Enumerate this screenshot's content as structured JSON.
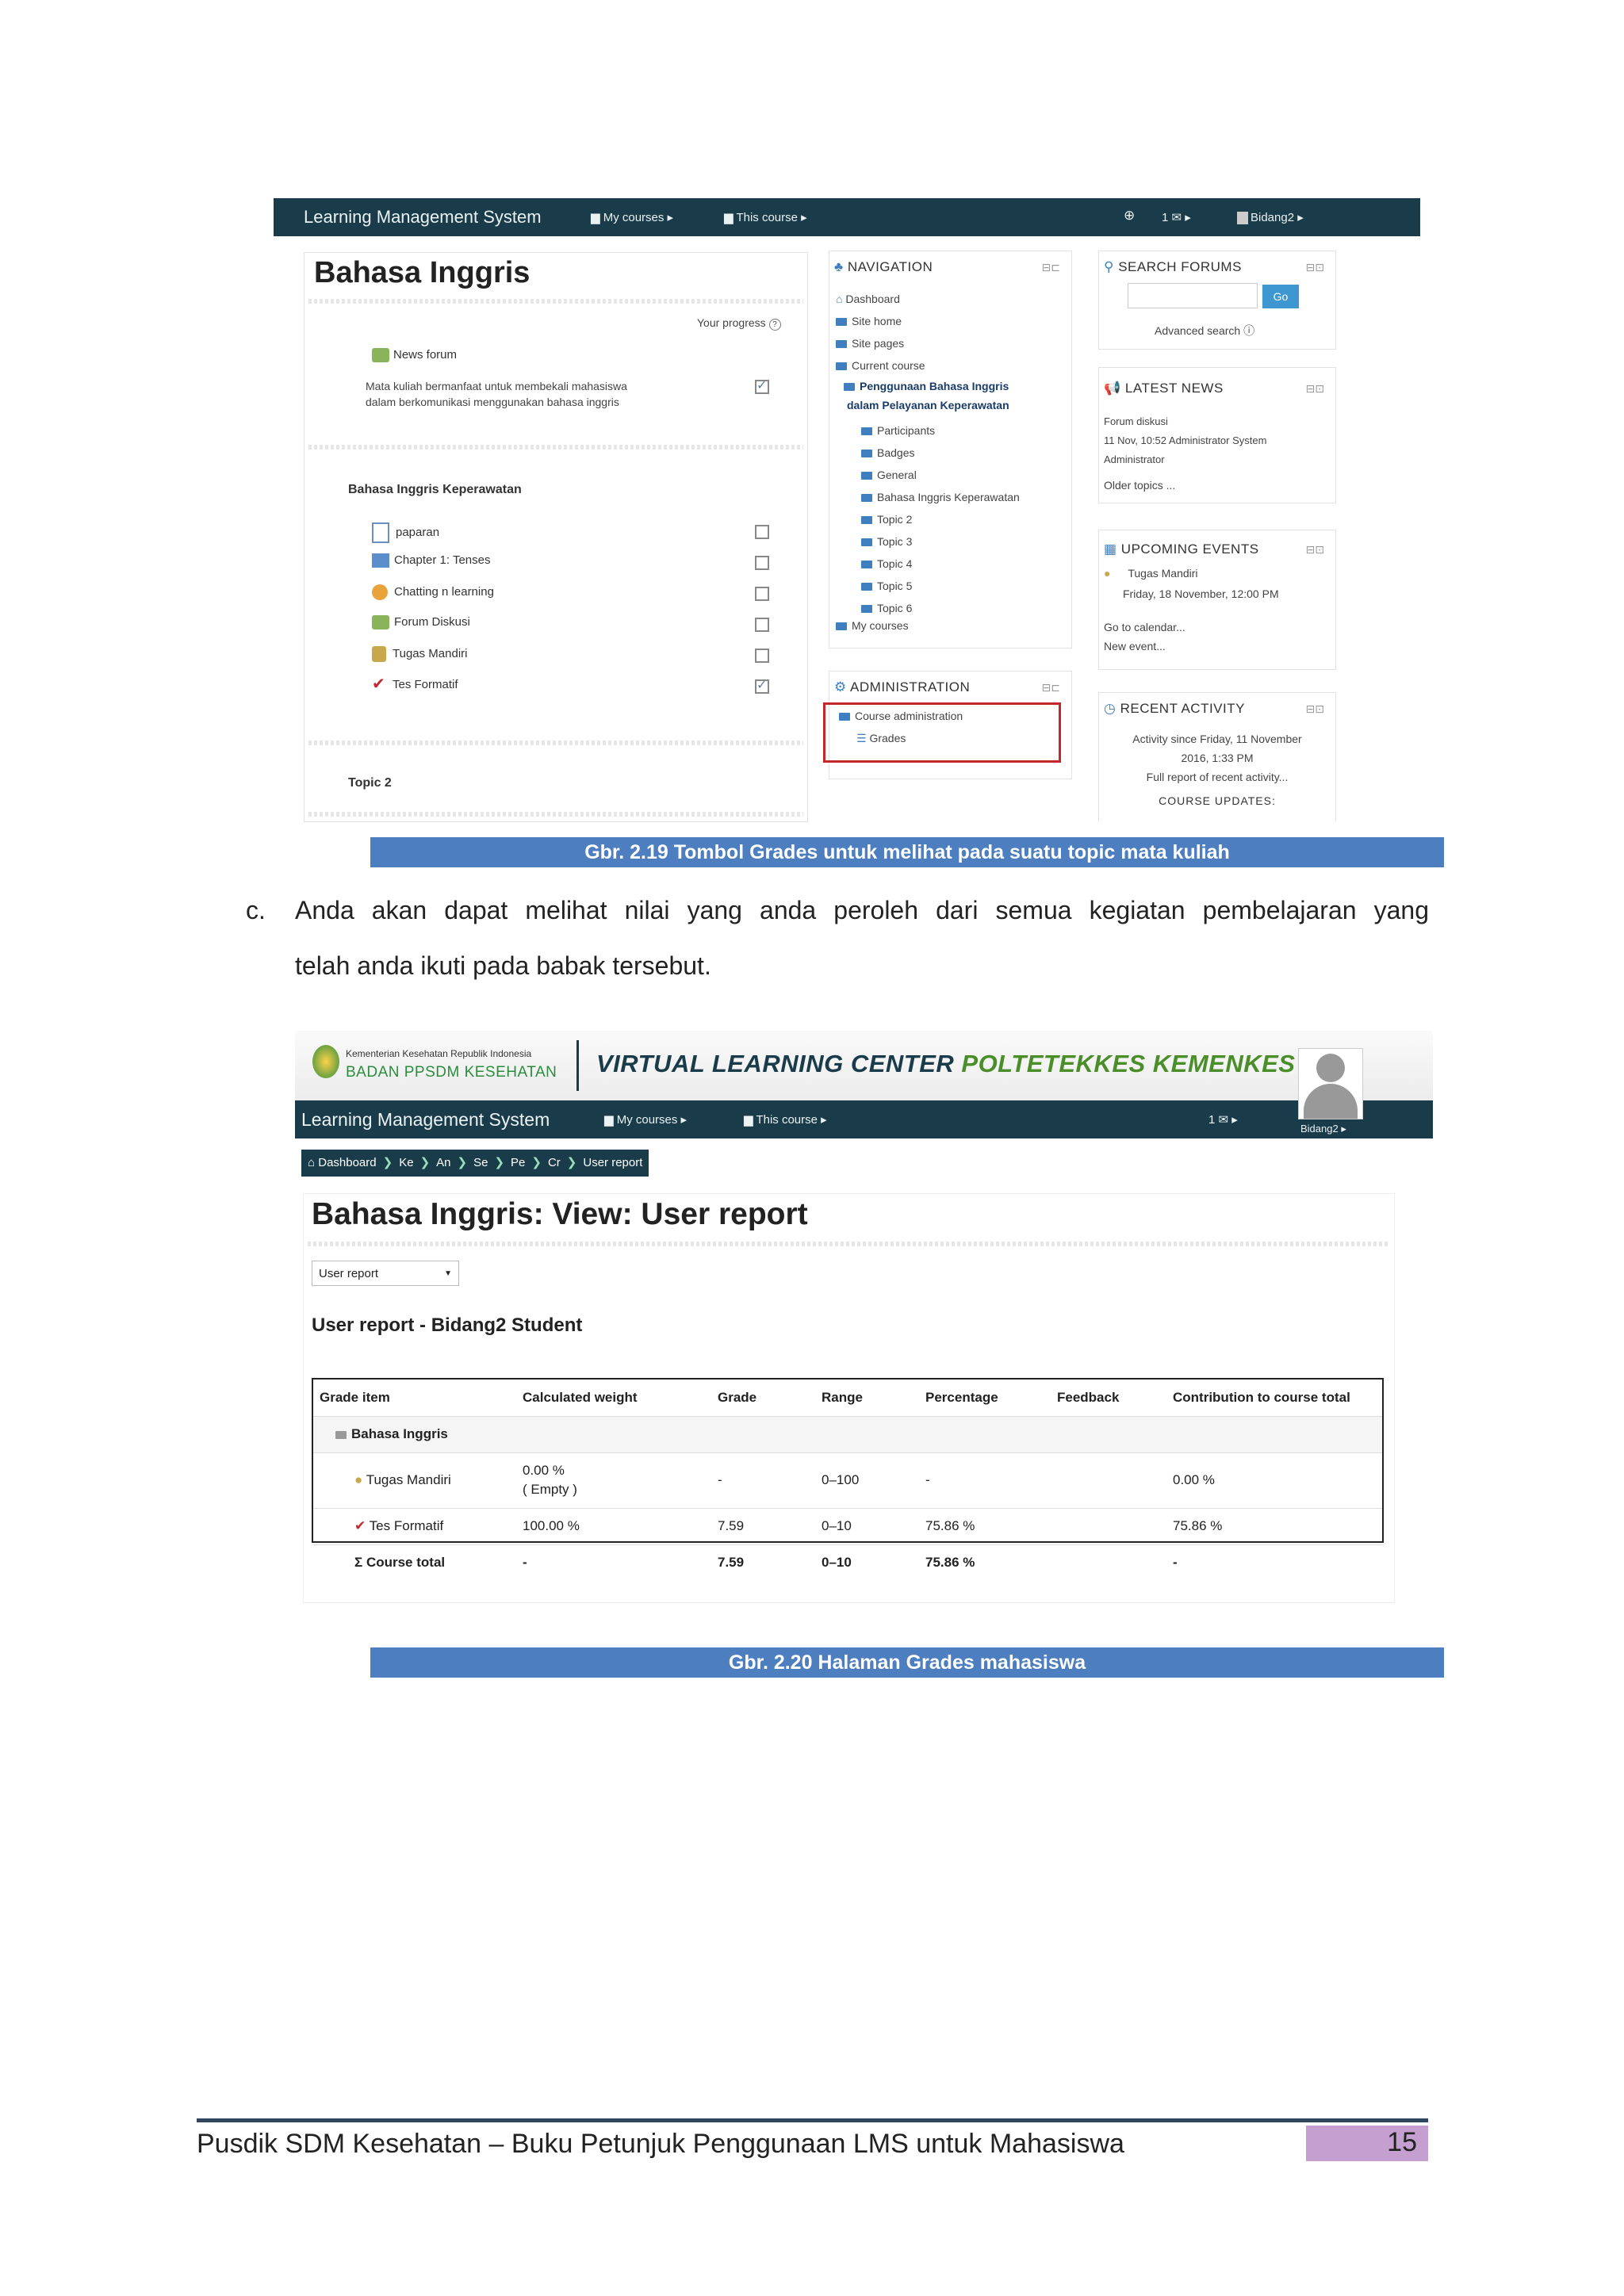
{
  "fig1": {
    "topbar": {
      "brand": "Learning Management System",
      "my_courses": "My courses ▸",
      "this_course": "This course ▸",
      "messages": "1 ✉ ▸",
      "user": "Bidang2 ▸"
    },
    "course_title": "Bahasa Inggris",
    "your_progress": "Your progress",
    "news_forum": "News forum",
    "description": [
      "Mata kuliah bermanfaat untuk membekali mahasiswa",
      "dalam berkomunikasi menggunakan bahasa inggris"
    ],
    "section_title": "Bahasa Inggris Keperawatan",
    "activities": [
      {
        "label": "paparan",
        "checked": false
      },
      {
        "label": "Chapter 1: Tenses",
        "checked": false
      },
      {
        "label": "Chatting n learning",
        "checked": false
      },
      {
        "label": "Forum Diskusi",
        "checked": false
      },
      {
        "label": "Tugas Mandiri",
        "checked": false
      },
      {
        "label": "Tes Formatif",
        "checked": true
      }
    ],
    "topic2": "Topic 2",
    "navigation": {
      "title": "NAVIGATION",
      "items": [
        "Dashboard",
        "Site home",
        "Site pages",
        "Current course"
      ],
      "course": [
        "Penggunaan Bahasa Inggris",
        "dalam Pelayanan Keperawatan"
      ],
      "sub": [
        "Participants",
        "Badges",
        "General",
        "Bahasa Inggris Keperawatan",
        "Topic 2",
        "Topic 3",
        "Topic 4",
        "Topic 5",
        "Topic 6"
      ],
      "my_courses": "My courses"
    },
    "administration": {
      "title": "ADMINISTRATION",
      "course_admin": "Course administration",
      "grades": "Grades"
    },
    "search_forums": {
      "title": "SEARCH FORUMS",
      "go": "Go",
      "advanced": "Advanced search"
    },
    "latest_news": {
      "title": "LATEST NEWS",
      "lines": [
        "Forum diskusi",
        "11 Nov, 10:52 Administrator System",
        "Administrator"
      ],
      "older": "Older topics ..."
    },
    "upcoming": {
      "title": "UPCOMING EVENTS",
      "event": "Tugas Mandiri",
      "date": "Friday, 18 November, 12:00 PM",
      "calendar": "Go to calendar...",
      "new_event": "New event..."
    },
    "recent": {
      "title": "RECENT ACTIVITY",
      "lines": [
        "Activity since Friday, 11 November",
        "2016, 1:33 PM",
        "Full report of recent activity..."
      ],
      "updates": "COURSE UPDATES:"
    }
  },
  "caption1": "Gbr. 2.19 Tombol Grades untuk melihat pada suatu topic mata kuliah",
  "list_marker": "c.",
  "paragraph": [
    "Anda akan dapat melihat nilai yang anda peroleh dari semua kegiatan pembelajaran yang",
    "telah anda ikuti pada babak tersebut."
  ],
  "fig2": {
    "logo_line1": "Kementerian Kesehatan Republik Indonesia",
    "logo_line2": "BADAN PPSDM KESEHATAN",
    "banner_part1": "VIRTUAL LEARNING CENTER ",
    "banner_part2": "POLTETEKKES KEMENKES",
    "navbar": {
      "brand": "Learning Management System",
      "my_courses": "My courses ▸",
      "this_course": "This course ▸",
      "messages": "1 ✉ ▸",
      "user": "Bidang2 ▸"
    },
    "breadcrumbs": [
      "Dashboard",
      "Ke",
      "An",
      "Se",
      "Pe",
      "Cr",
      "User report"
    ],
    "title": "Bahasa Inggris: View: User report",
    "select_value": "User report",
    "subtitle": "User report - Bidang2 Student",
    "headers": [
      "Grade item",
      "Calculated weight",
      "Grade",
      "Range",
      "Percentage",
      "Feedback",
      "Contribution to course total"
    ],
    "category": "Bahasa Inggris",
    "rows": [
      {
        "item": "Tugas Mandiri",
        "weight": "0.00 %",
        "weight2": "( Empty )",
        "grade": "-",
        "range": "0–100",
        "percentage": "-",
        "feedback": "",
        "contribution": "0.00 %"
      },
      {
        "item": "Tes Formatif",
        "weight": "100.00 %",
        "weight2": "",
        "grade": "7.59",
        "range": "0–10",
        "percentage": "75.86 %",
        "feedback": "",
        "contribution": "75.86 %"
      }
    ],
    "total": {
      "item": "Course total",
      "weight": "-",
      "grade": "7.59",
      "range": "0–10",
      "percentage": "75.86 %",
      "feedback": "",
      "contribution": "-"
    }
  },
  "caption2": "Gbr. 2.20 Halaman Grades mahasiswa",
  "footer": {
    "text": "Pusdik SDM Kesehatan – Buku Petunjuk Penggunaan LMS untuk Mahasiswa",
    "page": "15"
  }
}
